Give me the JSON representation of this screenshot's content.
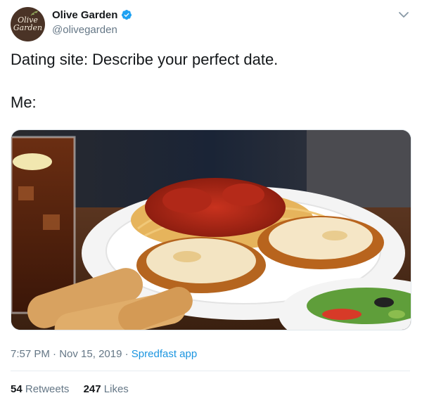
{
  "account": {
    "name": "Olive Garden",
    "handle": "@olivegarden",
    "avatar_text_line1": "Olive",
    "avatar_text_line2": "Garden"
  },
  "tweet": {
    "line1": "Dating site: Describe your perfect date.",
    "line2": "Me:"
  },
  "meta": {
    "time": "7:57 PM",
    "date": "Nov 15, 2019",
    "separator": "·",
    "app": "Spredfast app"
  },
  "stats": {
    "retweets_count": "54",
    "retweets_label": "Retweets",
    "likes_count": "247",
    "likes_label": "Likes"
  },
  "colors": {
    "link": "#1b95e0",
    "muted": "#657786",
    "verified": "#1da1f2"
  },
  "icons": [
    "verified-badge-icon",
    "chevron-down-icon"
  ]
}
